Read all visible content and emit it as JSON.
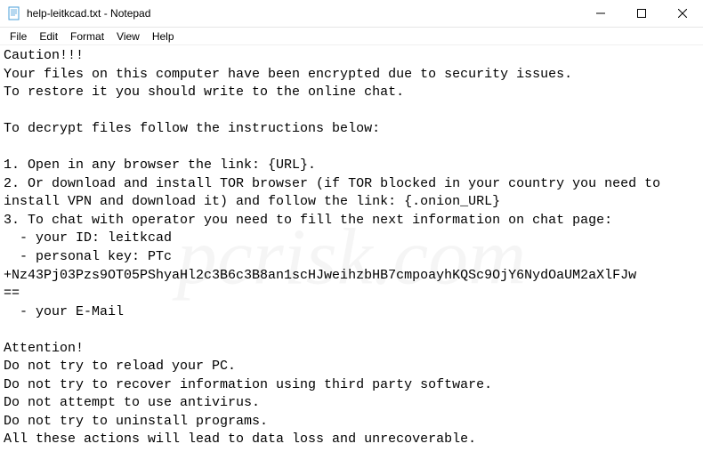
{
  "window": {
    "title": "help-leitkcad.txt - Notepad"
  },
  "menubar": {
    "file": "File",
    "edit": "Edit",
    "format": "Format",
    "view": "View",
    "help": "Help"
  },
  "content": {
    "text": "Caution!!!\nYour files on this computer have been encrypted due to security issues.\nTo restore it you should write to the online chat.\n\nTo decrypt files follow the instructions below:\n\n1. Open in any browser the link: {URL}.\n2. Or download and install TOR browser (if TOR blocked in your country you need to install VPN and download it) and follow the link: {.onion_URL}\n3. To chat with operator you need to fill the next information on chat page:\n  - your ID: leitkcad\n  - personal key: PTc\n+Nz43Pj03Pzs9OT05PShyaHl2c3B6c3B8an1scHJweihzbHB7cmpoayhKQSc9OjY6NydOaUM2aXlFJw\n==\n  - your E-Mail\n\nAttention!\nDo not try to reload your PC.\nDo not try to recover information using third party software.\nDo not attempt to use antivirus.\nDo not try to uninstall programs.\nAll these actions will lead to data loss and unrecoverable."
  },
  "watermark": {
    "text": "pcrisk.com"
  }
}
